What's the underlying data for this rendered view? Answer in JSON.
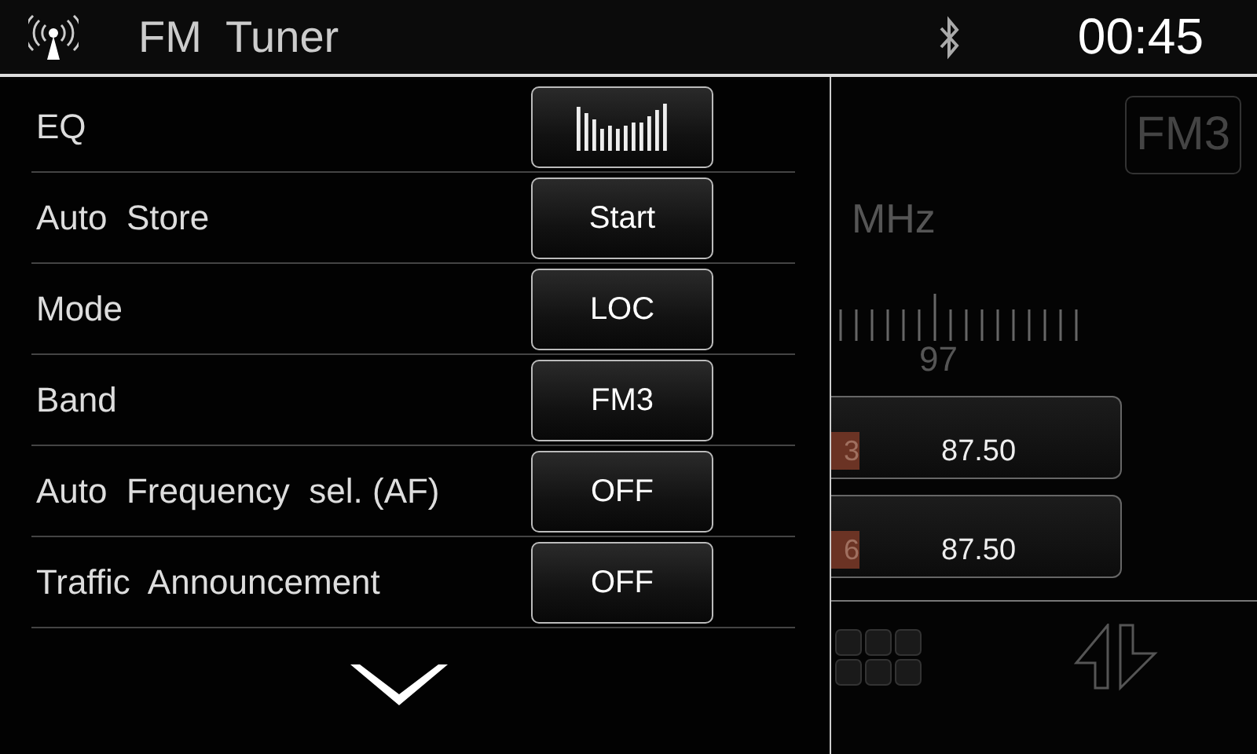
{
  "header": {
    "title": "FM  Tuner",
    "clock": "00:45"
  },
  "menu": {
    "items": [
      {
        "label": "EQ",
        "kind": "icon"
      },
      {
        "label": "Auto  Store",
        "kind": "text",
        "value": "Start"
      },
      {
        "label": "Mode",
        "kind": "text",
        "value": "LOC"
      },
      {
        "label": "Band",
        "kind": "text",
        "value": "FM3"
      },
      {
        "label": "Auto  Frequency  sel. (AF)",
        "kind": "text",
        "value": "OFF"
      },
      {
        "label": "Traffic  Announcement",
        "kind": "text",
        "value": "OFF"
      }
    ]
  },
  "tuner": {
    "band": "FM3",
    "unit": "MHz",
    "scale_label": "97",
    "presets": [
      {
        "number": "3",
        "frequency": "87.50"
      },
      {
        "number": "6",
        "frequency": "87.50"
      }
    ]
  }
}
